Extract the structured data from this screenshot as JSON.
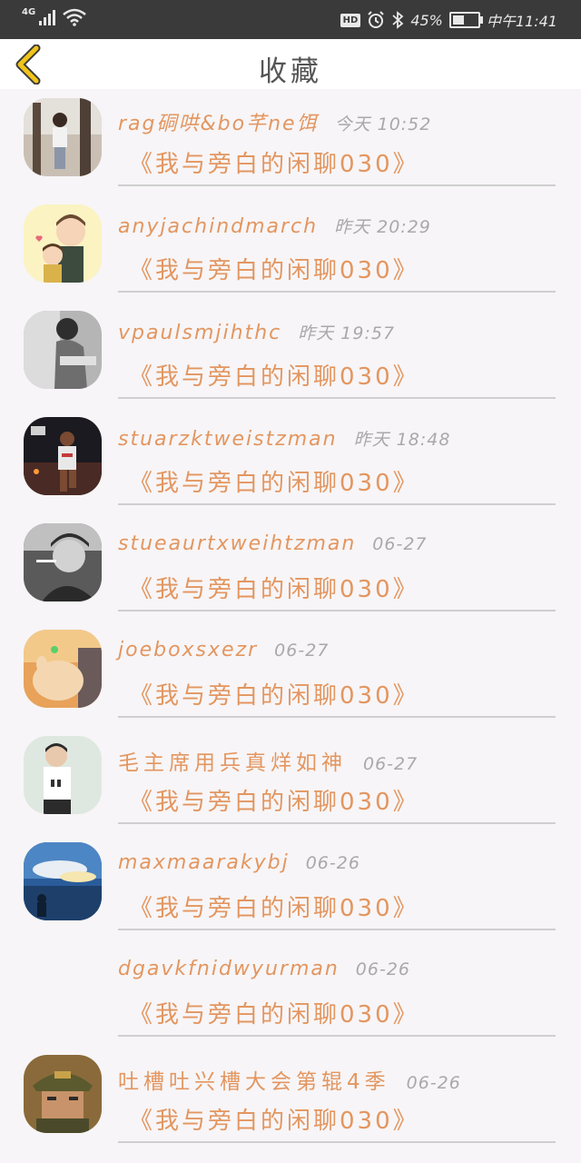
{
  "status_bar": {
    "network": "4G",
    "hd": "HD",
    "battery_pct": "45%",
    "battery_level": 0.45,
    "time": "中午11:41"
  },
  "header": {
    "title": "收藏",
    "back_icon": "chevron-left-icon",
    "accent_color": "#f0c419"
  },
  "items": [
    {
      "name": "rag硐哄&bo芊ne饵",
      "time": "今天 10:52",
      "title": "《我与旁白的闲聊030》",
      "avatar": "girl-tree-photo"
    },
    {
      "name": "anyjachindmarch",
      "time": "昨天 20:29",
      "title": "《我与旁白的闲聊030》",
      "avatar": "cartoon-couple"
    },
    {
      "name": "vpaulsmjihthc",
      "time": "昨天 19:57",
      "title": "《我与旁白的闲聊030》",
      "avatar": "bw-portrait"
    },
    {
      "name": "stuarzktweistzman",
      "time": "昨天 18:48",
      "title": "《我与旁白的闲聊030》",
      "avatar": "basketball-player"
    },
    {
      "name": "stueaurtxweihtzman",
      "time": "06-27",
      "title": "《我与旁白的闲聊030》",
      "avatar": "smoking-man"
    },
    {
      "name": "joeboxsxezr",
      "time": "06-27",
      "title": "《我与旁白的闲聊030》",
      "avatar": "pig-sunset"
    },
    {
      "name": "毛主席用兵真烊如神",
      "time": "06-27",
      "title": "《我与旁白的闲聊030》",
      "avatar": "boy-jersey-27"
    },
    {
      "name": "maxmaarakybj",
      "time": "06-26",
      "title": "《我与旁白的闲聊030》",
      "avatar": "sea-sky"
    },
    {
      "name": "dgavkfnidwyurman",
      "time": "06-26",
      "title": "《我与旁白的闲聊030》",
      "avatar": ""
    },
    {
      "name": "吐槽吐兴槽大会第辊4季",
      "time": "06-26",
      "title": "《我与旁白的闲聊030》",
      "avatar": "soldier-cap"
    }
  ]
}
